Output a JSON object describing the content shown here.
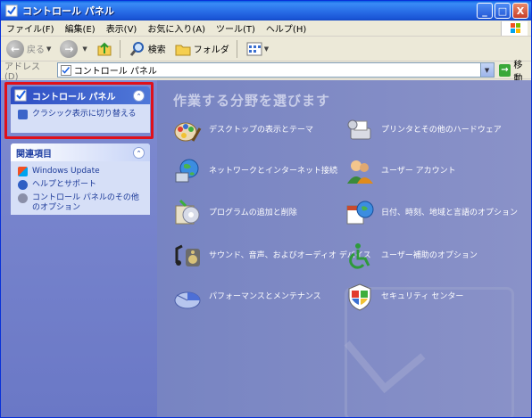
{
  "window": {
    "title": "コントロール パネル",
    "controls": {
      "minimize": "_",
      "maximize": "□",
      "close": "X"
    }
  },
  "menu": [
    "ファイル(F)",
    "編集(E)",
    "表示(V)",
    "お気に入り(A)",
    "ツール(T)",
    "ヘルプ(H)"
  ],
  "toolbar": {
    "back": "戻る",
    "search": "検索",
    "folders": "フォルダ"
  },
  "address": {
    "label": "アドレス(D)",
    "value": "コントロール パネル",
    "go": "移動"
  },
  "sidebar": {
    "control_panel": {
      "title": "コントロール パネル",
      "tasks": [
        "クラシック表示に切り替える"
      ]
    },
    "related": {
      "title": "関連項目",
      "items": [
        "Windows Update",
        "ヘルプとサポート",
        "コントロール パネルのその他のオプション"
      ]
    }
  },
  "main": {
    "heading": "作業する分野を選びます",
    "categories": [
      {
        "label": "デスクトップの表示とテーマ",
        "icon": "desktop-themes-icon"
      },
      {
        "label": "プリンタとその他のハードウェア",
        "icon": "printer-hardware-icon"
      },
      {
        "label": "ネットワークとインターネット接続",
        "icon": "network-internet-icon"
      },
      {
        "label": "ユーザー アカウント",
        "icon": "user-accounts-icon"
      },
      {
        "label": "プログラムの追加と削除",
        "icon": "add-remove-programs-icon"
      },
      {
        "label": "日付、時刻、地域と言語のオプション",
        "icon": "date-time-region-icon"
      },
      {
        "label": "サウンド、音声、およびオーディオ デバイス",
        "icon": "sound-audio-icon"
      },
      {
        "label": "ユーザー補助のオプション",
        "icon": "accessibility-icon"
      },
      {
        "label": "パフォーマンスとメンテナンス",
        "icon": "performance-maintenance-icon"
      },
      {
        "label": "セキュリティ センター",
        "icon": "security-center-icon"
      }
    ]
  },
  "colors": {
    "highlight": "#e0101a",
    "content_bg": "#7784c2"
  }
}
